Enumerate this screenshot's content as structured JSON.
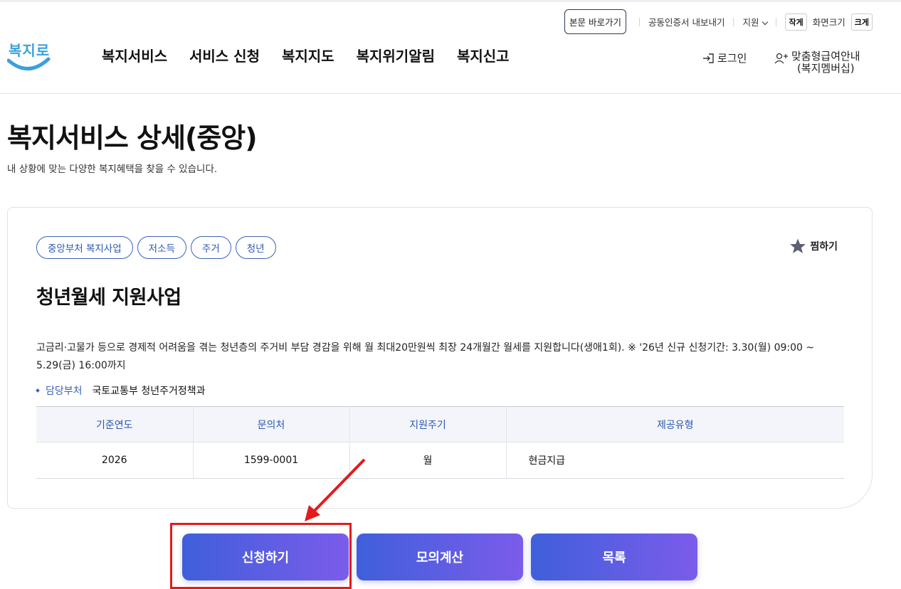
{
  "header": {
    "logo_text": "복지로",
    "util": {
      "skip_label": "본문 바로가기",
      "cert_label": "공동인증서 내보내기",
      "support_label": "지원",
      "small_label": "작게",
      "size_label": "화면크기",
      "large_label": "크게"
    },
    "nav": [
      "복지서비스",
      "서비스 신청",
      "복지지도",
      "복지위기알림",
      "복지신고"
    ],
    "login_label": "로그인",
    "member_line1": "맞춤형급여안내",
    "member_line2": "(복지멤버십)"
  },
  "page": {
    "title": "복지서비스 상세(중앙)",
    "description": "내 상황에 맞는 다양한 복지혜택을 찾을 수 있습니다."
  },
  "service": {
    "tags": [
      "중앙부처 복지사업",
      "저소득",
      "주거",
      "청년"
    ],
    "favorite_label": "찜하기",
    "title": "청년월세 지원사업",
    "description": "고금리·고물가 등으로 경제적 어려움을 겪는 청년층의 주거비 부담 경감을 위해 월 최대20만원씩 최장 24개월간 월세를 지원합니다(생애1회). ※ '26년 신규 신청기간: 3.30(월) 09:00 ~ 5.29(금) 16:00까지",
    "dept_label": "담당부처",
    "dept_value": "국토교통부 청년주거정책과",
    "table": {
      "headers": [
        "기준연도",
        "문의처",
        "지원주기",
        "제공유형"
      ],
      "row": [
        "2026",
        "1599-0001",
        "월",
        "현금지급"
      ]
    }
  },
  "actions": {
    "apply_label": "신청하기",
    "simulate_label": "모의계산",
    "list_label": "목록"
  },
  "colors": {
    "accent": "#2c57b0",
    "button_start": "#3f5fdb",
    "button_end": "#7b5cea",
    "annotation": "#e31b1b"
  }
}
